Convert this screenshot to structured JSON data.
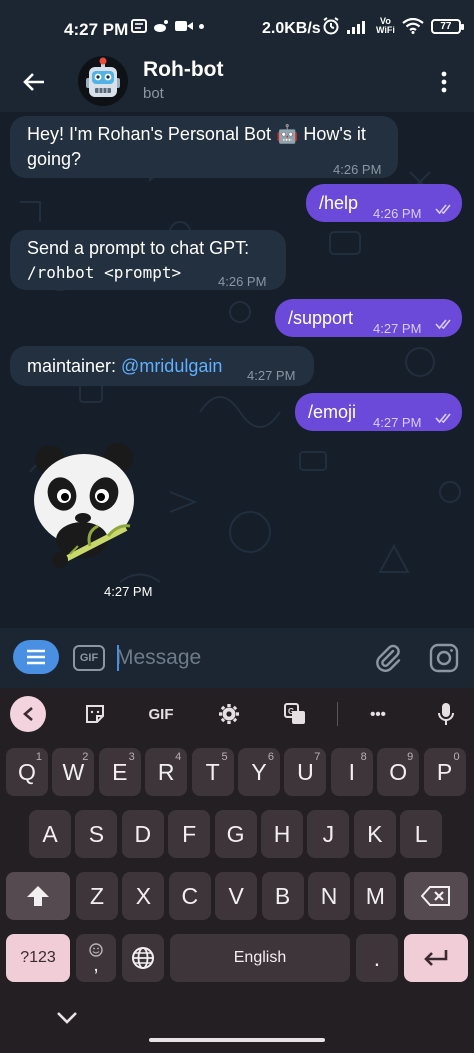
{
  "status_bar": {
    "time": "4:27 PM",
    "net_speed": "2.0KB/s",
    "vowifi_top": "Vo",
    "vowifi_bottom": "WiFi",
    "battery": "77"
  },
  "header": {
    "title": "Roh-bot",
    "subtitle": "bot",
    "avatar_icon": "robot-avatar",
    "back_icon": "arrow-left-icon",
    "menu_icon": "more-vertical-icon"
  },
  "messages": [
    {
      "dir": "in",
      "line1": "Hey! I'm Rohan's Personal Bot 🤖 How's it",
      "line2": "going?",
      "time": "4:26 PM"
    },
    {
      "dir": "out",
      "text": "/help",
      "time": "4:26 PM"
    },
    {
      "dir": "in",
      "line1": "Send a prompt to chat GPT:",
      "line2": "/rohbot <prompt>",
      "time": "4:26 PM"
    },
    {
      "dir": "out",
      "text": "/support",
      "time": "4:27 PM"
    },
    {
      "dir": "in",
      "prefix": "maintainer: ",
      "link": "@mridulgain",
      "time": "4:27 PM"
    },
    {
      "dir": "out",
      "text": "/emoji",
      "time": "4:27 PM"
    }
  ],
  "sticker": {
    "icon": "panda-sticker",
    "time": "4:27 PM"
  },
  "composer": {
    "placeholder": "Message",
    "gif_label": "GIF"
  },
  "keyboard": {
    "toolbar": {
      "gif_label": "GIF",
      "more_label": "•••"
    },
    "row1": [
      {
        "k": "Q",
        "h": "1"
      },
      {
        "k": "W",
        "h": "2"
      },
      {
        "k": "E",
        "h": "3"
      },
      {
        "k": "R",
        "h": "4"
      },
      {
        "k": "T",
        "h": "5"
      },
      {
        "k": "Y",
        "h": "6"
      },
      {
        "k": "U",
        "h": "7"
      },
      {
        "k": "I",
        "h": "8"
      },
      {
        "k": "O",
        "h": "9"
      },
      {
        "k": "P",
        "h": "0"
      }
    ],
    "row2": [
      "A",
      "S",
      "D",
      "F",
      "G",
      "H",
      "J",
      "K",
      "L"
    ],
    "row3": [
      "Z",
      "X",
      "C",
      "V",
      "B",
      "N",
      "M"
    ],
    "sym_label": "?123",
    "emoji_comma": ",",
    "space_label": "English",
    "period": "."
  },
  "colors": {
    "accent": "#6c4ad9",
    "incoming": "#23303f",
    "link": "#5fb0ff",
    "keyboard_bg": "#241f22"
  }
}
